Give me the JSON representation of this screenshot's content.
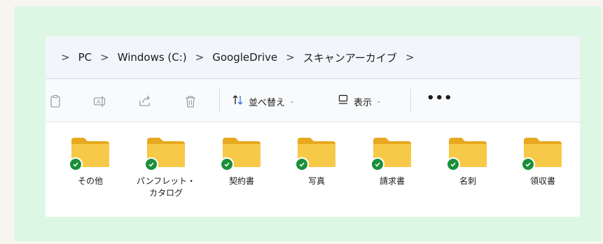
{
  "breadcrumb": {
    "separator": ">",
    "items": [
      "PC",
      "Windows (C:)",
      "GoogleDrive",
      "スキャンアーカイブ"
    ]
  },
  "toolbar": {
    "icons": [
      "paste-icon",
      "rename-icon",
      "share-icon",
      "delete-icon"
    ],
    "sort_label": "並べ替え",
    "view_label": "表示",
    "more_label": "•••"
  },
  "folders": [
    {
      "name": "その他"
    },
    {
      "name": "パンフレット・\nカタログ"
    },
    {
      "name": "契約書"
    },
    {
      "name": "写真"
    },
    {
      "name": "請求書"
    },
    {
      "name": "名刺"
    },
    {
      "name": "領収書"
    }
  ],
  "colors": {
    "background_green": "#dcf8e5",
    "folder_yellow": "#f7c948",
    "sync_check_green": "#1a8f3a"
  }
}
